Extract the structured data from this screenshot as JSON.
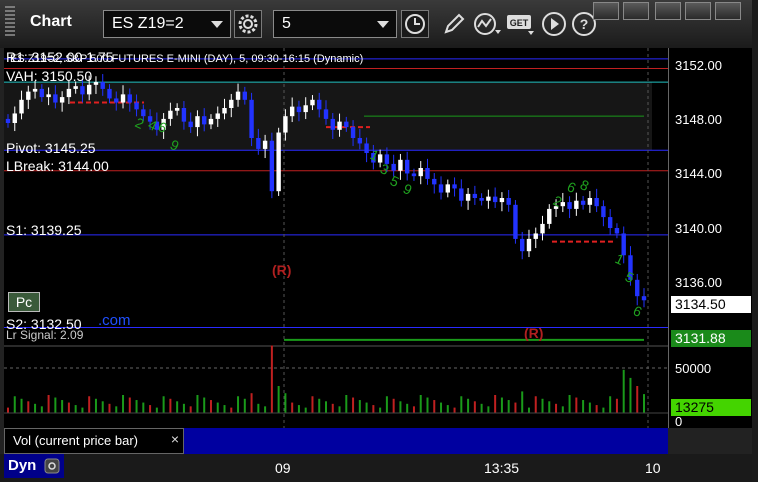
{
  "app": {
    "title": "Chart"
  },
  "toolbar": {
    "symbol": "ES Z19=2",
    "interval": "5"
  },
  "chart": {
    "legend": "ES Z19=2, S&P 500 FUTURES E-MINI (DAY), 5, 09:30-16:15 (Dynamic)",
    "levels": {
      "r1": "R1: 3152.00",
      "r1_extra": "1.75",
      "vah": "VAH: 3150.50",
      "pivot": "Pivot: 3145.25",
      "lbreak": "LBreak: 3144.00",
      "s1": "S1: 3139.25",
      "s2": "S2: 3132.50",
      "s2_overlap": "Lr Signal: 2.09",
      "com": ".com"
    },
    "markers": {
      "r1": "(R)",
      "r2": "(R)",
      "pc": "Pc"
    },
    "price_ticks": [
      "3152.00",
      "3148.00",
      "3144.00",
      "3140.00",
      "3136.00"
    ],
    "last_price": "3134.50",
    "green_tag": "3131.88",
    "volume_ticks": [
      "50000",
      "0"
    ],
    "volume_value": "13275",
    "volume_label": "Vol (current price bar)",
    "volume_close": "×",
    "time_labels": [
      "09",
      "13:35",
      "10"
    ],
    "footer": {
      "mode": "Dyn"
    }
  },
  "chart_data": {
    "type": "candlestick",
    "y_range": [
      3131,
      3153
    ],
    "closes": [
      3147.5,
      3148.2,
      3149.2,
      3149.8,
      3150.0,
      3149.4,
      3149.6,
      3149.0,
      3149.4,
      3150.0,
      3150.2,
      3149.6,
      3150.3,
      3150.5,
      3150.0,
      3149.3,
      3149.0,
      3149.6,
      3149.0,
      3148.5,
      3148.0,
      3147.6,
      3147.0,
      3147.8,
      3148.4,
      3148.6,
      3147.6,
      3147.2,
      3148.0,
      3147.4,
      3147.8,
      3148.2,
      3148.6,
      3149.2,
      3149.8,
      3149.2,
      3146.4,
      3145.6,
      3146.2,
      3142.5,
      3146.8,
      3148.0,
      3148.7,
      3148.3,
      3148.8,
      3149.2,
      3148.5,
      3147.8,
      3147.0,
      3147.6,
      3147.2,
      3146.4,
      3146.0,
      3145.3,
      3144.6,
      3145.2,
      3144.5,
      3144.0,
      3144.8,
      3143.8,
      3143.6,
      3144.2,
      3143.4,
      3143.0,
      3142.4,
      3143.0,
      3142.7,
      3141.8,
      3142.3,
      3142.0,
      3141.8,
      3142.1,
      3141.7,
      3142.0,
      3141.5,
      3139.0,
      3138.1,
      3139.0,
      3139.4,
      3140.1,
      3141.2,
      3141.4,
      3141.7,
      3141.2,
      3141.8,
      3141.5,
      3142.0,
      3141.4,
      3140.6,
      3139.8,
      3139.4,
      3137.8,
      3136.0,
      3134.8,
      3134.5
    ],
    "volume_max": 75000
  }
}
